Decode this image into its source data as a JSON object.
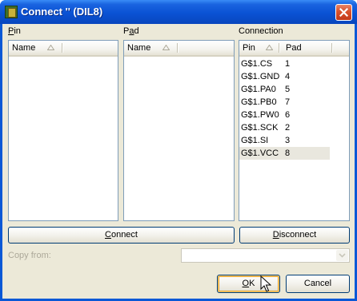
{
  "window": {
    "title": "Connect '' (DIL8)",
    "close_icon": "close-icon"
  },
  "pin_panel": {
    "label": "Pin",
    "mnemonic": "P",
    "rest": "in",
    "header": "Name"
  },
  "pad_panel": {
    "label": "Pad",
    "mnemonic": "a",
    "pre": "P",
    "rest": "d",
    "header": "Name"
  },
  "connection_panel": {
    "label": "Connection",
    "headers": {
      "pin": "Pin",
      "pad": "Pad"
    },
    "rows": [
      {
        "pin": "G$1.CS",
        "pad": "1"
      },
      {
        "pin": "G$1.GND",
        "pad": "4"
      },
      {
        "pin": "G$1.PA0",
        "pad": "5"
      },
      {
        "pin": "G$1.PB0",
        "pad": "7"
      },
      {
        "pin": "G$1.PW0",
        "pad": "6"
      },
      {
        "pin": "G$1.SCK",
        "pad": "2"
      },
      {
        "pin": "G$1.SI",
        "pad": "3"
      },
      {
        "pin": "G$1.VCC",
        "pad": "8"
      }
    ],
    "selected_index": 7
  },
  "buttons": {
    "connect": {
      "mnemonic": "C",
      "rest": "onnect"
    },
    "disconnect": {
      "mnemonic": "D",
      "rest": "isconnect"
    },
    "ok": {
      "mnemonic": "O",
      "rest": "K"
    },
    "cancel": {
      "label": "Cancel"
    }
  },
  "copy_from": {
    "label": "Copy from:",
    "value": ""
  },
  "colors": {
    "titlebar": "#0a52d4",
    "face": "#ece9d8",
    "border": "#7f9db9",
    "disabled_text": "#aca899"
  }
}
